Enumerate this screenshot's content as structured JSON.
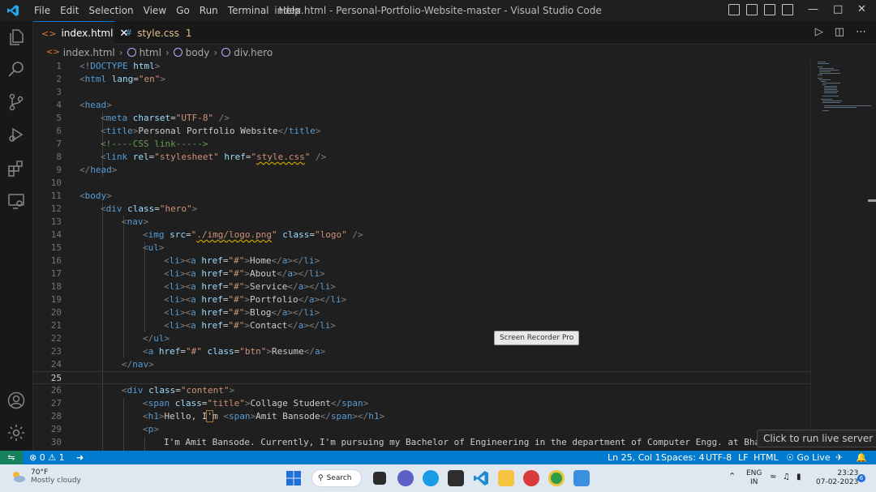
{
  "titlebar": {
    "menu": [
      "File",
      "Edit",
      "Selection",
      "View",
      "Go",
      "Run",
      "Terminal",
      "Help"
    ],
    "window_title": "index.html - Personal-Portfolio-Website-master - Visual Studio Code"
  },
  "tabs": [
    {
      "label": "index.html",
      "icon": "html-file-icon",
      "active": true
    },
    {
      "label": "style.css",
      "icon": "css-file-icon",
      "badge": "1",
      "active": false
    }
  ],
  "breadcrumb": [
    "index.html",
    "html",
    "body",
    "div.hero"
  ],
  "editor": {
    "current_line": 25,
    "lines": [
      {
        "n": "1"
      },
      {
        "n": "2"
      },
      {
        "n": "3"
      },
      {
        "n": "4"
      },
      {
        "n": "5"
      },
      {
        "n": "6"
      },
      {
        "n": "7"
      },
      {
        "n": "8"
      },
      {
        "n": "9"
      },
      {
        "n": "10"
      },
      {
        "n": "11"
      },
      {
        "n": "12"
      },
      {
        "n": "13"
      },
      {
        "n": "14"
      },
      {
        "n": "15"
      },
      {
        "n": "16"
      },
      {
        "n": "17"
      },
      {
        "n": "18"
      },
      {
        "n": "19"
      },
      {
        "n": "20"
      },
      {
        "n": "21"
      },
      {
        "n": "22"
      },
      {
        "n": "23"
      },
      {
        "n": "24"
      },
      {
        "n": "25"
      },
      {
        "n": "26"
      },
      {
        "n": "27"
      },
      {
        "n": "28"
      },
      {
        "n": "29"
      },
      {
        "n": "30"
      }
    ],
    "code": {
      "l1_doctype": "!DOCTYPE",
      "l1_html": "html",
      "l2_tag": "html",
      "l2_attr": "lang",
      "l2_val": "\"en\"",
      "l4_tag": "head",
      "l5_tag": "meta",
      "l5_attr": "charset",
      "l5_val": "\"UTF-8\"",
      "l6_tag": "title",
      "l6_text": "Personal Portfolio Website",
      "l7_comment": "<!----CSS link----->",
      "l8_tag": "link",
      "l8_attr1": "rel",
      "l8_val1": "\"stylesheet\"",
      "l8_attr2": "href",
      "l8_val2": "style.css",
      "l9_tag": "head",
      "l11_tag": "body",
      "l12_tag": "div",
      "l12_attr": "class",
      "l12_val": "\"hero\"",
      "l13_tag": "nav",
      "l14_tag": "img",
      "l14_attr1": "src",
      "l14_val1": "./img/logo.png",
      "l14_attr2": "class",
      "l14_val2": "\"logo\"",
      "l15_tag": "ul",
      "nav_links": [
        "Home",
        "About",
        "Service",
        "Portfolio",
        "Blog",
        "Contact"
      ],
      "li_tag": "li",
      "a_tag": "a",
      "href_attr": "href",
      "href_val": "\"#\"",
      "l22_tag": "ul",
      "l23_attr2": "class",
      "l23_val2": "\"btn\"",
      "l23_text": "Resume",
      "l24_tag": "nav",
      "l26_tag": "div",
      "l26_attr": "class",
      "l26_val": "\"content\"",
      "l27_tag": "span",
      "l27_attr": "class",
      "l27_val": "\"title\"",
      "l27_text": "Collage Student",
      "l28_tag": "h1",
      "l28_text_a": "Hello, I",
      "l28_text_b": "m ",
      "l28_span": "span",
      "l28_name": "Amit Bansode",
      "l29_tag": "p",
      "l30_text": "I'm Amit Bansode. Currently, I'm pursuing my Bachelor of Engineering in the department of Computer Engg. at Bhara"
    }
  },
  "tooltips": {
    "recorder": "Screen Recorder Pro",
    "live_server": "Click to run live server"
  },
  "statusbar": {
    "errors": "0",
    "warnings": "1",
    "position": "Ln 25, Col 1",
    "spaces": "Spaces: 4",
    "encoding": "UTF-8",
    "eol": "LF",
    "language": "HTML",
    "go_live": "Go Live"
  },
  "taskbar": {
    "temperature": "70°F",
    "weather": "Mostly cloudy",
    "search": "Search",
    "lang": "ENG",
    "region": "IN",
    "time": "23:23",
    "date": "07-02-2023",
    "notifications": "6"
  },
  "colors": {
    "accent": "#007acc",
    "tag": "#569cd6",
    "attribute": "#9cdcfe",
    "string": "#ce9178",
    "comment": "#6a9955"
  }
}
